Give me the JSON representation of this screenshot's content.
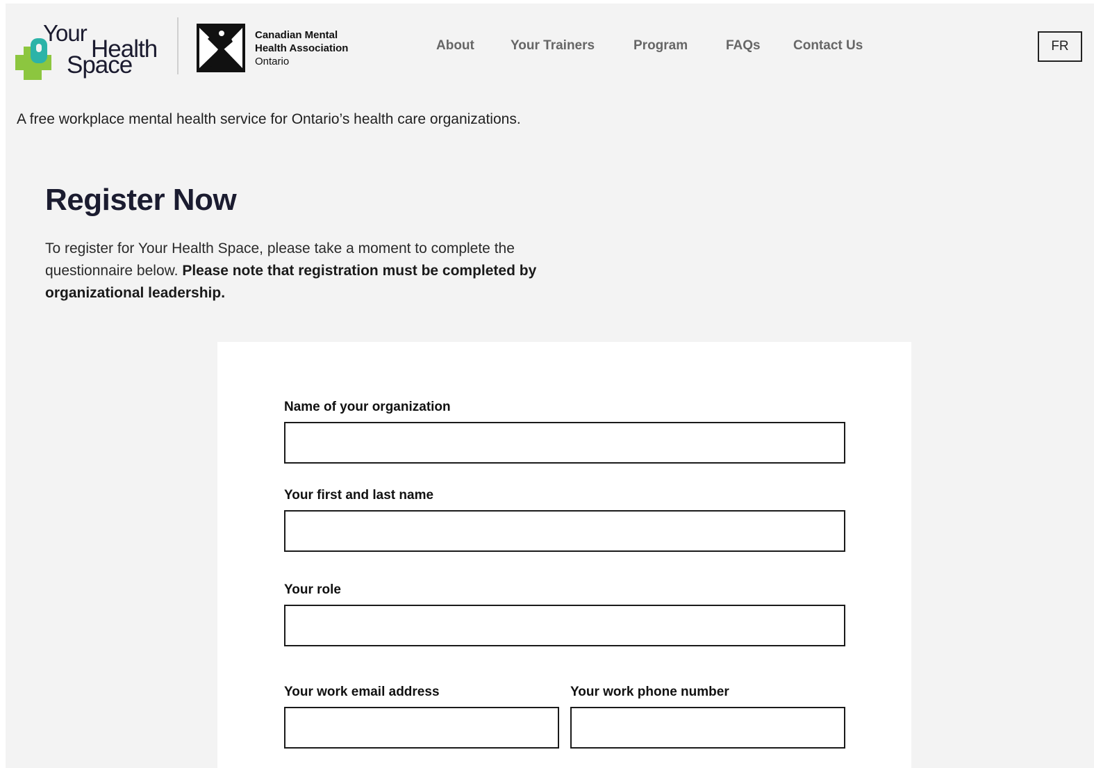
{
  "header": {
    "logo": {
      "word1": "Your",
      "word2": "Health",
      "word3": "Space"
    },
    "partner": {
      "line1": "Canadian Mental",
      "line2": "Health Association",
      "line3": "Ontario"
    },
    "nav": [
      {
        "label": "About"
      },
      {
        "label": "Your Trainers"
      },
      {
        "label": "Program"
      },
      {
        "label": "FAQs"
      },
      {
        "label": "Contact Us"
      }
    ],
    "language_button": "FR"
  },
  "tagline": "A free workplace mental health service for Ontario’s health care organizations.",
  "main": {
    "title": "Register Now",
    "intro_text": "To register for Your Health Space, please take a moment to complete the questionnaire below.",
    "intro_bold": "Please note that registration must be completed by organizational leadership."
  },
  "form": {
    "fields": [
      {
        "label": "Name of your organization",
        "value": "",
        "placeholder": ""
      },
      {
        "label": "Your first and last name",
        "value": "",
        "placeholder": ""
      },
      {
        "label": "Your role",
        "value": "",
        "placeholder": ""
      },
      {
        "label": "Your work email address",
        "value": "",
        "placeholder": ""
      },
      {
        "label": "Your work phone number",
        "value": "",
        "placeholder": ""
      }
    ]
  },
  "colors": {
    "page_background": "#f3f3f3",
    "logo_green": "#8cc63f",
    "logo_teal": "#2cb3a8",
    "heading": "#1b1c30",
    "nav_text": "#666666"
  }
}
